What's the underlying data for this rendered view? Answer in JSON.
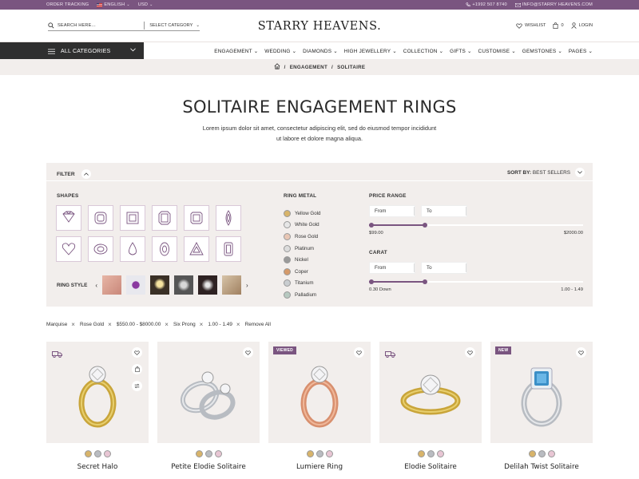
{
  "topbar": {
    "order_tracking": "ORDER TRACKING",
    "language": "ENGLISH",
    "currency": "USD",
    "phone": "+1992 507 8740",
    "email": "INFO@STARRY HEAVENS.COM"
  },
  "header": {
    "search_placeholder": "SEARCH HERE...",
    "select_category": "SELECT CATEGORY",
    "logo": "STARRY HEAVENS.",
    "wishlist": "WISHLIST",
    "cart_count": "0",
    "login": "LOGIN"
  },
  "nav": {
    "all_categories": "ALL CATEGORIES",
    "items": [
      "ENGAGEMENT",
      "WEDDING",
      "DIAMONDS",
      "HIGH JEWELLERY",
      "COLLECTION",
      "GIFTS",
      "CUSTOMISE",
      "GEMSTONES",
      "PAGES"
    ]
  },
  "breadcrumb": {
    "items": [
      "ENGAGEMENT",
      "SOLITAIRE"
    ],
    "separator": "/"
  },
  "page": {
    "title": "SOLITAIRE ENGAGEMENT RINGS",
    "description": "Lorem ipsum dolor sit amet, consectetur adipiscing elit, sed do eiusmod tempor incididunt ut labore et dolore magna aliqua."
  },
  "filter": {
    "label": "FILTER",
    "sort_prefix": "SORT BY:",
    "sort_value": "BEST SELLERS",
    "shapes_heading": "SHAPES",
    "shapes": [
      "princess-cut-icon",
      "cushion-cut-icon",
      "asscher-cut-icon",
      "radiant-cut-icon",
      "emerald-cut-icon",
      "marquise-cut-icon",
      "heart-cut-icon",
      "oval-cut-icon",
      "pear-cut-icon",
      "oval-tall-cut-icon",
      "trillion-cut-icon",
      "baguette-cut-icon"
    ],
    "ring_style_label": "RING STYLE",
    "ring_metal_heading": "RING METAL",
    "metals": [
      {
        "label": "Yellow Gold",
        "color": "#d8b46a"
      },
      {
        "label": "White Gold",
        "color": "#e6e6e6"
      },
      {
        "label": "Rose Gold",
        "color": "#e8c6b4"
      },
      {
        "label": "Platinum",
        "color": "#dcdcdc"
      },
      {
        "label": "Nickel",
        "color": "#9a9a9a"
      },
      {
        "label": "Coper",
        "color": "#d59a6a"
      },
      {
        "label": "Titanium",
        "color": "#c9cdd0"
      },
      {
        "label": "Palladium",
        "color": "#b7c9c0"
      }
    ],
    "price": {
      "heading": "PRICE RANGE",
      "from_placeholder": "From",
      "to_placeholder": "To",
      "min_label": "$99.00",
      "max_label": "$2000.00",
      "low_fraction": 0,
      "high_fraction": 0.26
    },
    "carat": {
      "heading": "CARAT",
      "from_placeholder": "From",
      "to_placeholder": "To",
      "min_label": "0.30 Down",
      "max_label": "1.00 - 1.49",
      "low_fraction": 0,
      "high_fraction": 0.26
    }
  },
  "active_filters": [
    "Marquise",
    "Rose Gold",
    "$550.00 - $8000.00",
    "Six Prong",
    "1.00 - 1.49"
  ],
  "remove_all": "Remove All",
  "products": [
    {
      "name": "Secret Halo",
      "badge": "",
      "metal": "yellow"
    },
    {
      "name": "Petite Elodie Solitaire",
      "badge": "",
      "metal": "white"
    },
    {
      "name": "Lumiere Ring",
      "badge": "VIEWED",
      "metal": "rose"
    },
    {
      "name": "Elodie Solitaire",
      "badge": "",
      "metal": "yellow"
    },
    {
      "name": "Delilah Twist Solitaire",
      "badge": "NEW",
      "metal": "white"
    }
  ],
  "colors": {
    "accent": "#7a5580",
    "panel": "#f2eeec",
    "dark": "#2f2f2f"
  }
}
